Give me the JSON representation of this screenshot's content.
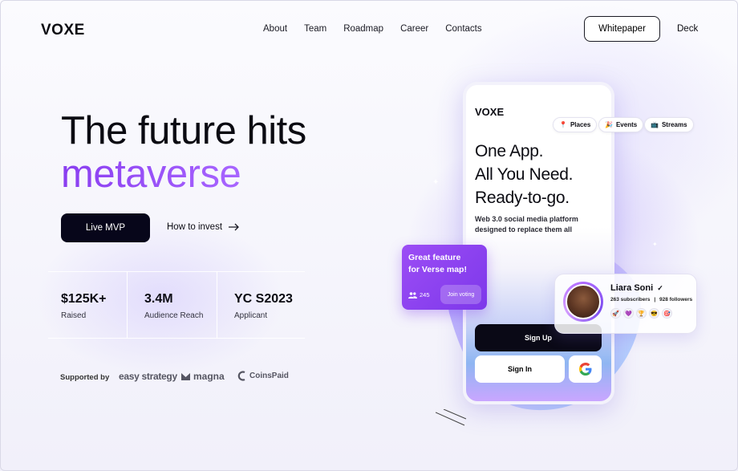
{
  "header": {
    "logo": "VOXE",
    "nav": [
      "About",
      "Team",
      "Roadmap",
      "Career",
      "Contacts"
    ],
    "whitepaper": "Whitepaper",
    "deck": "Deck"
  },
  "hero": {
    "line1": "The future hits",
    "line2": "metaverse",
    "primary_button": "Live MVP",
    "secondary_link": "How to invest"
  },
  "stats": [
    {
      "value": "$125K+",
      "label": "Raised"
    },
    {
      "value": "3.4M",
      "label": "Audience Reach"
    },
    {
      "value": "YC S2023",
      "label": "Applicant"
    }
  ],
  "supported": {
    "label": "Supported by",
    "partners": [
      "easy strategy",
      "magna",
      "CoinsPaid"
    ]
  },
  "phone": {
    "logo": "VOXE",
    "headline": [
      "One App.",
      "All You Need.",
      "Ready-to-go."
    ],
    "subtitle": "Web 3.0 social media platform designed to replace them all",
    "signup": "Sign Up",
    "signin": "Sign In",
    "chips": [
      "Places",
      "Events",
      "Streams"
    ]
  },
  "feature_card": {
    "title_line1": "Great feature",
    "title_line2": "for Verse map!",
    "count": "245",
    "vote": "Join voting"
  },
  "profile": {
    "name": "Liara Soni",
    "subscribers": "263 subscribers",
    "followers": "928 followers"
  },
  "colors": {
    "accent": "#8a3ef0",
    "dark": "#07061a"
  }
}
